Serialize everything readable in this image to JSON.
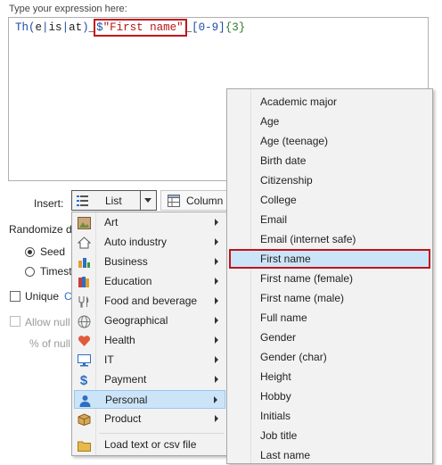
{
  "expression": {
    "label": "Type your expression here:",
    "tokens": {
      "t1": "Th(",
      "t2": "e",
      "t3": "|",
      "t4": "is",
      "t5": "|",
      "t6": "at",
      "t7": ")",
      "t8": "_",
      "t9": "$",
      "t10": "\"First name\"",
      "t11": "_",
      "t12": "[0-9]",
      "t13": "{3}"
    }
  },
  "insert": {
    "label": "Insert:",
    "list_label": "List",
    "column_label": "Column"
  },
  "randomize": {
    "label": "Randomize da",
    "seed_label": "Seed",
    "timestamp_label": "Timesta",
    "unique_label": "Unique",
    "unique_extra": "C",
    "allow_null_label": "Allow null",
    "percent_null_label": "% of null"
  },
  "menu": {
    "items": [
      {
        "label": "Art",
        "icon": "art-icon"
      },
      {
        "label": "Auto industry",
        "icon": "house-icon"
      },
      {
        "label": "Business",
        "icon": "business-icon"
      },
      {
        "label": "Education",
        "icon": "books-icon"
      },
      {
        "label": "Food and beverage",
        "icon": "food-icon"
      },
      {
        "label": "Geographical",
        "icon": "globe-icon"
      },
      {
        "label": "Health",
        "icon": "heart-icon"
      },
      {
        "label": "IT",
        "icon": "monitor-icon"
      },
      {
        "label": "Payment",
        "icon": "dollar-icon"
      },
      {
        "label": "Personal",
        "icon": "person-icon"
      },
      {
        "label": "Product",
        "icon": "box-icon"
      }
    ],
    "load_label": "Load text or csv file"
  },
  "submenu": {
    "items": [
      "Academic major",
      "Age",
      "Age (teenage)",
      "Birth date",
      "Citizenship",
      "College",
      "Email",
      "Email (internet safe)",
      "First name",
      "First name (female)",
      "First name (male)",
      "Full name",
      "Gender",
      "Gender (char)",
      "Height",
      "Hobby",
      "Initials",
      "Job title",
      "Last name"
    ],
    "selected": "First name"
  },
  "colors": {
    "highlight_border": "#c0141c",
    "selection_fill": "#cce4f7",
    "menu_bg": "#f2f2f2",
    "code_blue": "#1c4ba8",
    "code_red": "#b81515",
    "code_green": "#2a7a2a"
  }
}
